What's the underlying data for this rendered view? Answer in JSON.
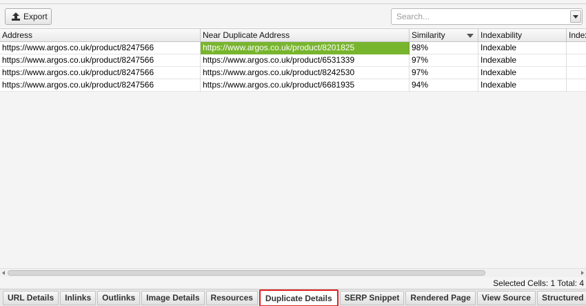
{
  "toolbar": {
    "export_label": "Export",
    "search_placeholder": "Search..."
  },
  "table": {
    "columns": [
      "Address",
      "Near Duplicate Address",
      "Similarity",
      "Indexability",
      "Indexa"
    ],
    "sorted_column": "Similarity",
    "sort_direction": "descending",
    "rows": [
      [
        "https://www.argos.co.uk/product/8247566",
        "https://www.argos.co.uk/product/8201825",
        "98%",
        "Indexable",
        ""
      ],
      [
        "https://www.argos.co.uk/product/8247566",
        "https://www.argos.co.uk/product/6531339",
        "97%",
        "Indexable",
        ""
      ],
      [
        "https://www.argos.co.uk/product/8247566",
        "https://www.argos.co.uk/product/8242530",
        "97%",
        "Indexable",
        ""
      ],
      [
        "https://www.argos.co.uk/product/8247566",
        "https://www.argos.co.uk/product/6681935",
        "94%",
        "Indexable",
        ""
      ]
    ],
    "selected_cell": {
      "row": 0,
      "column": 1
    },
    "selected_color": "#78b52e"
  },
  "status": {
    "text": "Selected Cells:  1  Total:  4"
  },
  "tabs": [
    "URL Details",
    "Inlinks",
    "Outlinks",
    "Image Details",
    "Resources",
    "Duplicate Details",
    "SERP Snippet",
    "Rendered Page",
    "View Source",
    "Structured Data Details"
  ],
  "active_tab": "Duplicate Details",
  "highlight_color": "#e02020"
}
